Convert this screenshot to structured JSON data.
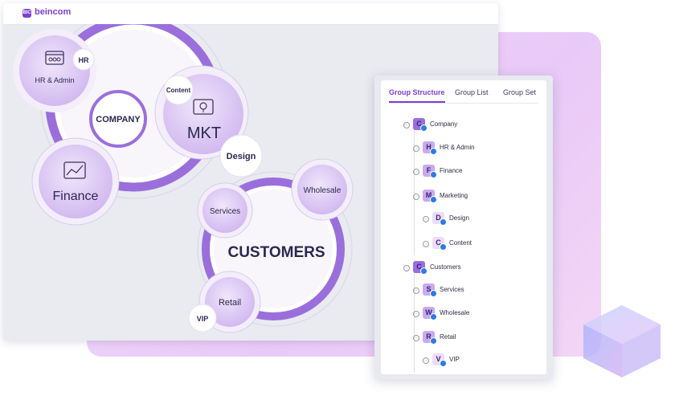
{
  "brand": {
    "logo_badge": "BIC",
    "name": "beincom",
    "accent": "#7c3fd0"
  },
  "diagram": {
    "company": "COMPANY",
    "hr_admin": "HR & Admin",
    "hr_tag": "HR",
    "content_tag": "Content",
    "mkt": "MKT",
    "design": "Design",
    "finance": "Finance",
    "customers": "CUSTOMERS",
    "services": "Services",
    "wholesale": "Wholesale",
    "retail": "Retail",
    "vip": "VIP"
  },
  "panel": {
    "tabs": [
      "Group Structure",
      "Group List",
      "Group Set"
    ],
    "active_tab": "Group Structure",
    "tree": [
      {
        "letter": "C",
        "label": "Company",
        "level": 0,
        "tone": "c"
      },
      {
        "letter": "H",
        "label": "HR & Admin",
        "level": 1,
        "tone": "m"
      },
      {
        "letter": "F",
        "label": "Finance",
        "level": 1,
        "tone": "m"
      },
      {
        "letter": "M",
        "label": "Marketing",
        "level": 1,
        "tone": "m"
      },
      {
        "letter": "D",
        "label": "Design",
        "level": 2,
        "tone": "l"
      },
      {
        "letter": "C",
        "label": "Content",
        "level": 2,
        "tone": "l"
      },
      {
        "letter": "C",
        "label": "Customers",
        "level": 0,
        "tone": "c"
      },
      {
        "letter": "S",
        "label": "Services",
        "level": 1,
        "tone": "m"
      },
      {
        "letter": "W",
        "label": "Wholesale",
        "level": 1,
        "tone": "m"
      },
      {
        "letter": "R",
        "label": "Retail",
        "level": 1,
        "tone": "m"
      },
      {
        "letter": "V",
        "label": "VIP",
        "level": 2,
        "tone": "l"
      }
    ]
  }
}
